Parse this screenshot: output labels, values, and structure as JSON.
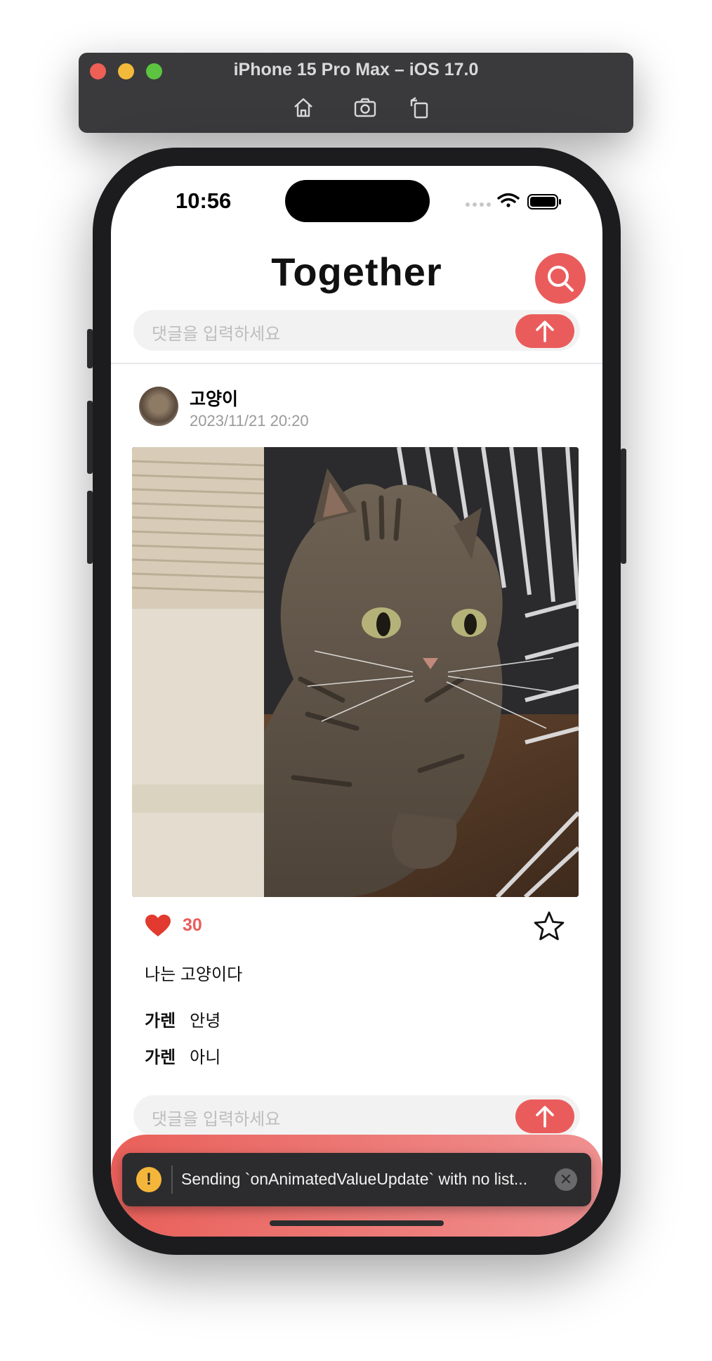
{
  "simulator": {
    "title": "iPhone 15 Pro Max – iOS 17.0",
    "tools": [
      "home-icon",
      "screenshot-icon",
      "rotate-icon"
    ]
  },
  "status_bar": {
    "time": "10:56"
  },
  "app": {
    "title": "Together",
    "accent_color": "#ea5c5c"
  },
  "comment_input": {
    "placeholder": "댓글을 입력하세요"
  },
  "post": {
    "author": "고양이",
    "date": "2023/11/21 20:20",
    "likes": "30",
    "caption": "나는 고양이다",
    "comments": [
      {
        "user": "가렌",
        "text": "안녕"
      },
      {
        "user": "가렌",
        "text": "아니"
      }
    ]
  },
  "toast": {
    "message": "Sending `onAnimatedValueUpdate` with no list...",
    "warn_symbol": "!",
    "close_symbol": "✕"
  }
}
